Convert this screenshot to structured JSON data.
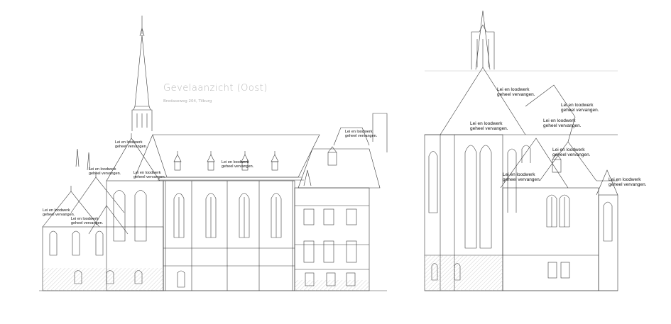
{
  "drawing": {
    "title": "Gevelaanzicht (Oost)",
    "subtitle": "Bredaseweg 204, Tilburg"
  },
  "annotations": {
    "roof_note_line1": "Lei en loodwerk",
    "roof_note_line2": "geheel vervangen."
  },
  "colors": {
    "line": "#3a3a3a",
    "light_line": "#8c8c8c",
    "title_gray": "#b9b9b9",
    "hatch": "#a0a0a0"
  }
}
